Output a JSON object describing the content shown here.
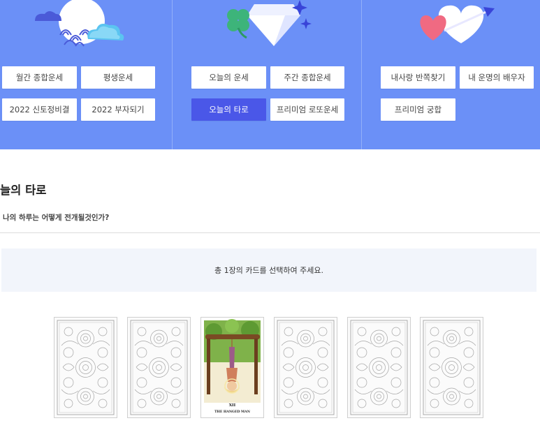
{
  "menu": {
    "group1": {
      "buttons": [
        {
          "label": "월간 종합운세"
        },
        {
          "label": "평생운세"
        },
        {
          "label": "2022 신토정비결"
        },
        {
          "label": "2022 부자되기"
        }
      ]
    },
    "group2": {
      "buttons": [
        {
          "label": "오늘의 운세"
        },
        {
          "label": "주간 종합운세"
        },
        {
          "label": "오늘의 타로",
          "active": true
        },
        {
          "label": "프리미엄 로또운세"
        }
      ]
    },
    "group3": {
      "buttons": [
        {
          "label": "내사랑 반쪽찾기"
        },
        {
          "label": "내 운명의 배우자"
        },
        {
          "label": "프리미엄 궁합"
        }
      ]
    }
  },
  "page": {
    "title": "늘의 타로",
    "subtitle": "나의 하루는 어떻게 전개될것인가?",
    "instruction": "총 1장의 카드를 선택하여 주세요."
  },
  "cards": [
    {
      "state": "back"
    },
    {
      "state": "back"
    },
    {
      "state": "revealed",
      "numeral": "XII",
      "name": "THE HANGED MAN"
    },
    {
      "state": "back"
    },
    {
      "state": "back"
    },
    {
      "state": "back"
    }
  ],
  "colors": {
    "banner": "#6b90f7",
    "active_button": "#4a57e8",
    "notice_bg": "#f2f5fb"
  },
  "icons": [
    "moon-wave-cloud-icon",
    "clover-diamond-icon",
    "hearts-arrow-icon"
  ]
}
